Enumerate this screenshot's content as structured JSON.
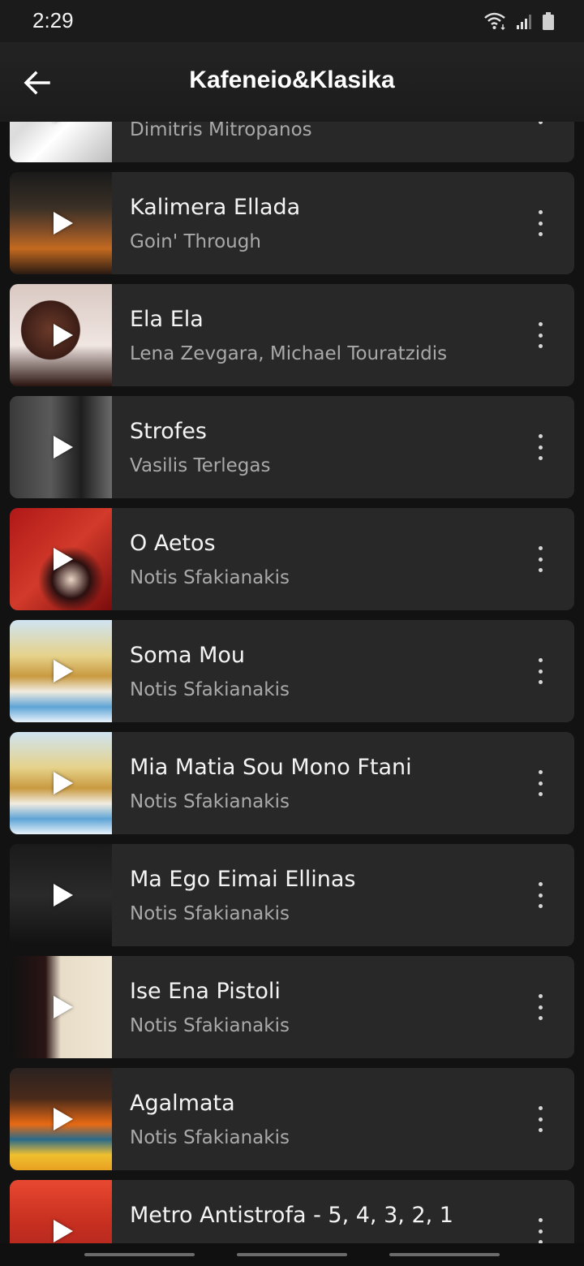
{
  "status_bar": {
    "time": "2:29"
  },
  "header": {
    "title": "Kafeneio&Klasika"
  },
  "tracks": [
    {
      "title": "",
      "artist": "Dimitris Mitropanos"
    },
    {
      "title": "Kalimera Ellada",
      "artist": "Goin' Through"
    },
    {
      "title": "Ela Ela",
      "artist": "Lena Zevgara, Michael Touratzidis"
    },
    {
      "title": "Strofes",
      "artist": "Vasilis Terlegas"
    },
    {
      "title": "O Aetos",
      "artist": "Notis Sfakianakis"
    },
    {
      "title": "Soma Mou",
      "artist": "Notis Sfakianakis"
    },
    {
      "title": "Mia Matia Sou Mono Ftani",
      "artist": "Notis Sfakianakis"
    },
    {
      "title": "Ma Ego Eimai Ellinas",
      "artist": "Notis Sfakianakis"
    },
    {
      "title": "Ise Ena Pistoli",
      "artist": "Notis Sfakianakis"
    },
    {
      "title": "Agalmata",
      "artist": "Notis Sfakianakis"
    },
    {
      "title": "Metro Antistrofa - 5, 4, 3, 2, 1",
      "artist": ""
    }
  ],
  "icons": {
    "back": "arrow-left-icon",
    "play": "play-icon",
    "more": "more-vertical-icon",
    "wifi": "wifi-icon",
    "signal": "signal-icon",
    "battery": "battery-icon"
  },
  "colors": {
    "background": "#121212",
    "card": "#282828",
    "text_primary": "#f4f4f4",
    "text_secondary": "#a9a9a9"
  }
}
